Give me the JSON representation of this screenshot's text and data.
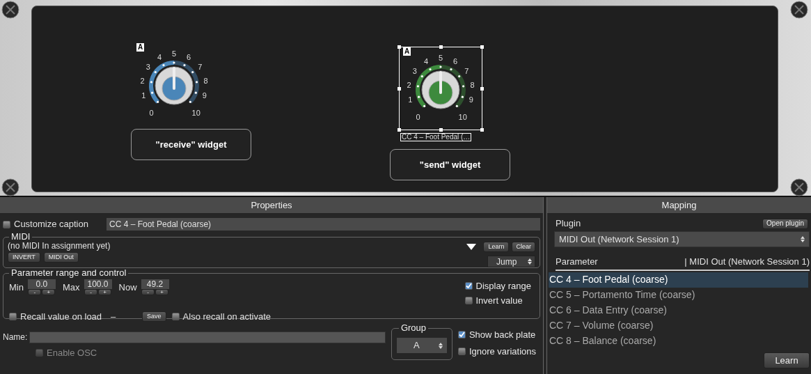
{
  "rack": {
    "widgets": [
      {
        "kind": "knob",
        "badge": "A",
        "color": "#4a86b8",
        "level": 0.5,
        "selected": false,
        "scale": [
          "0",
          "1",
          "2",
          "3",
          "4",
          "5",
          "6",
          "7",
          "8",
          "9",
          "10"
        ]
      },
      {
        "kind": "knob",
        "badge": "A",
        "color": "#3d8a3d",
        "level": 0.5,
        "selected": true,
        "caption": "CC 4 – Foot Pedal (…",
        "scale": [
          "0",
          "1",
          "2",
          "3",
          "4",
          "5",
          "6",
          "7",
          "8",
          "9",
          "10"
        ]
      }
    ],
    "labels": [
      "\"receive\" widget",
      "\"send\" widget"
    ]
  },
  "properties": {
    "title": "Properties",
    "customize_caption": {
      "label": "Customize caption",
      "checked": false,
      "value": "CC 4 – Foot Pedal (coarse)"
    },
    "midi": {
      "legend": "MIDI",
      "status": "(no MIDI In assignment yet)",
      "buttons": [
        "INVERT",
        "MIDI Out"
      ],
      "learn": "Learn",
      "clear": "Clear",
      "mode": "Jump"
    },
    "range": {
      "legend": "Parameter range and control",
      "fields": [
        {
          "label": "Min",
          "value": "0.0",
          "dec": "-",
          "inc": "+"
        },
        {
          "label": "Max",
          "value": "100.0",
          "dec": "-",
          "inc": "+"
        },
        {
          "label": "Now",
          "value": "49.2",
          "dec": "-",
          "inc": "+"
        }
      ],
      "options": [
        {
          "label": "Display range",
          "checked": true
        },
        {
          "label": "Invert value",
          "checked": false
        }
      ],
      "recall": {
        "label": "Recall value on load",
        "checked": false
      },
      "recall_value": "–",
      "save": "Save",
      "also_recall": {
        "label": "Also recall on activate",
        "checked": false
      }
    },
    "name": {
      "label": "Name:"
    },
    "enable_osc": {
      "label": "Enable OSC",
      "checked": false,
      "disabled": true
    },
    "group": {
      "legend": "Group",
      "value": "A"
    },
    "options": [
      {
        "label": "Show back plate",
        "checked": true
      },
      {
        "label": "Ignore variations",
        "checked": false
      }
    ]
  },
  "mapping": {
    "title": "Mapping",
    "plugin_label": "Plugin",
    "open_plugin": "Open plugin",
    "plugin": "MIDI Out (Network Session 1)",
    "columns": [
      "Parameter",
      "| MIDI Out (Network Session 1)"
    ],
    "rows": [
      {
        "label": "CC 4 – Foot Pedal (coarse)",
        "selected": true
      },
      {
        "label": "CC 5 – Portamento Time (coarse)",
        "selected": false
      },
      {
        "label": "CC 6 – Data Entry (coarse)",
        "selected": false
      },
      {
        "label": "CC 7 – Volume (coarse)",
        "selected": false
      },
      {
        "label": "CC 8 – Balance (coarse)",
        "selected": false
      }
    ],
    "learn": "Learn"
  }
}
